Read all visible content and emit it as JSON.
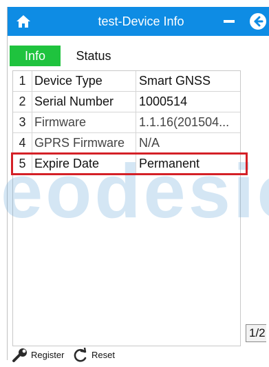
{
  "window": {
    "title": "test-Device Info"
  },
  "tabs": [
    {
      "label": "Info",
      "active": true
    },
    {
      "label": "Status",
      "active": false
    }
  ],
  "table": {
    "rows": [
      {
        "num": "1",
        "name": "Device Type",
        "value": "Smart GNSS"
      },
      {
        "num": "2",
        "name": "Serial Number",
        "value": "1000514"
      },
      {
        "num": "3",
        "name": "Firmware",
        "value": "1.1.16(201504..."
      },
      {
        "num": "4",
        "name": "GPRS Firmware",
        "value": "N/A"
      },
      {
        "num": "5",
        "name": "Expire Date",
        "value": "Permanent"
      }
    ],
    "highlighted_row": "5"
  },
  "pager": {
    "label": "1/2"
  },
  "footer": {
    "register_label": "Register",
    "reset_label": "Reset"
  },
  "watermark": "eodesic",
  "colors": {
    "titlebar": "#0e8ce4",
    "active_tab": "#1fc33e",
    "highlight": "#d42027"
  },
  "icons": {
    "home": "home-icon",
    "minimize": "minimize-icon",
    "back": "back-arrow-icon",
    "register": "wrench-icon",
    "reset": "refresh-icon"
  }
}
